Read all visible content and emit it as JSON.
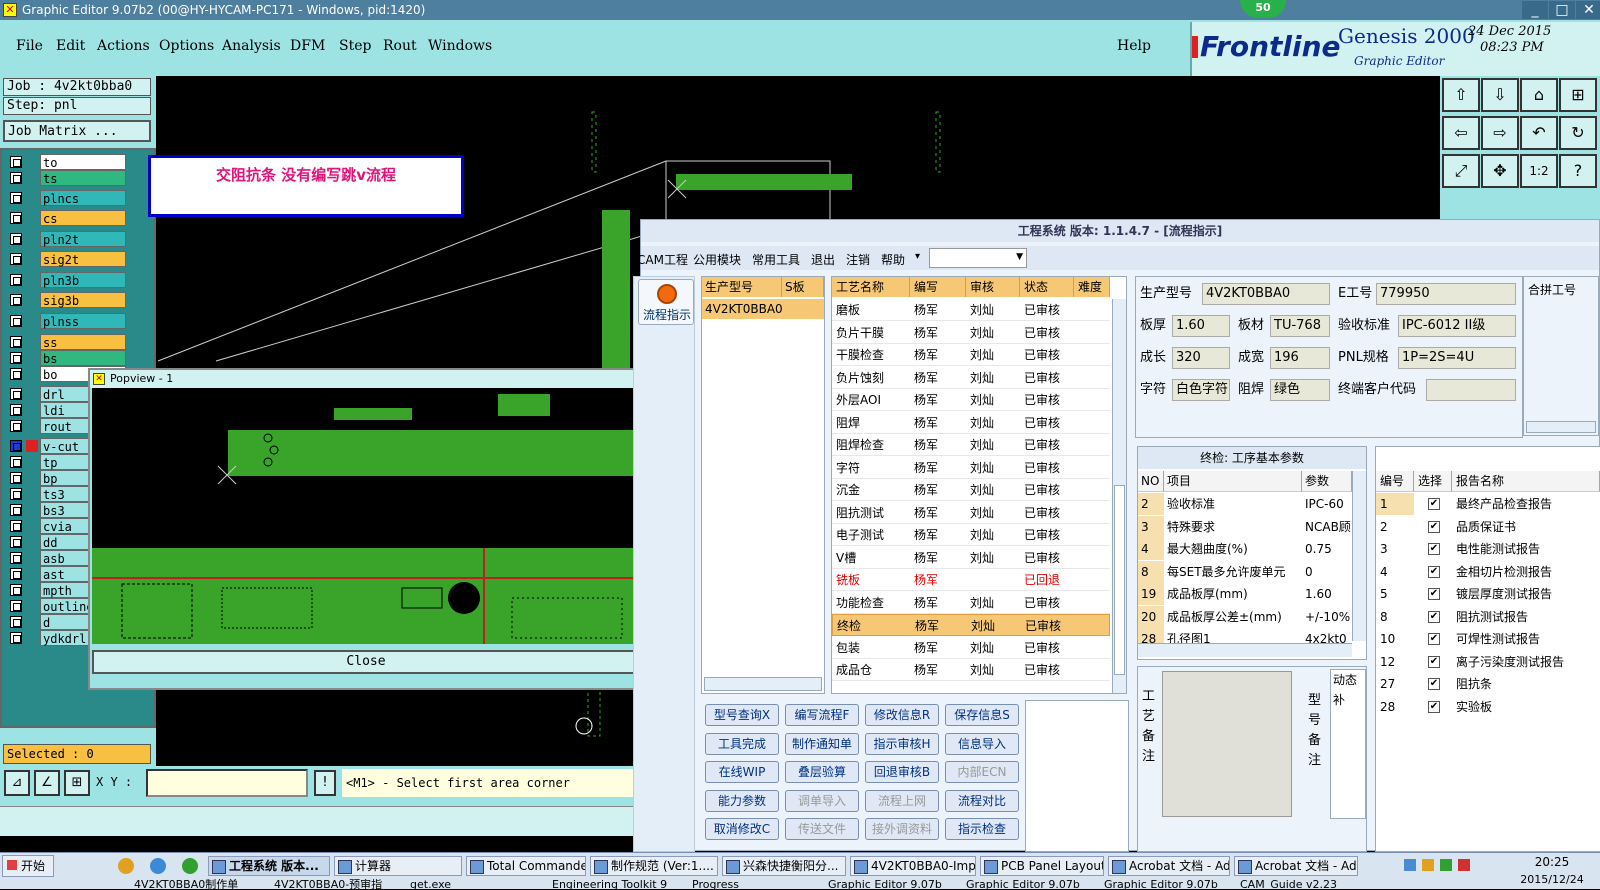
{
  "window": {
    "title": "Graphic Editor 9.07b2 (00@HY-HYCAM-PC171 - Windows, pid:1420)",
    "badge": "50"
  },
  "menu": {
    "items": [
      "File",
      "Edit",
      "Actions",
      "Options",
      "Analysis",
      "DFM",
      "Step",
      "Rout",
      "Windows"
    ],
    "help": "Help"
  },
  "brand": {
    "logo": "Frontline",
    "product": "Genesis 2000",
    "subtitle": "Graphic Editor",
    "date": "24 Dec 2015",
    "time": "08:23 PM"
  },
  "left": {
    "job": "Job : 4v2kt0bba0",
    "step": "Step: pnl",
    "job_matrix": "Job Matrix ...",
    "selected": "Selected : 0",
    "layers": [
      {
        "name": "to",
        "color": "#ffffff"
      },
      {
        "name": "ts",
        "color": "#30b880"
      },
      {
        "name": "plncs",
        "color": "#30b8b8"
      },
      {
        "name": "cs",
        "color": "#f8c040"
      },
      {
        "name": "pln2t",
        "color": "#30b8b8"
      },
      {
        "name": "sig2t",
        "color": "#f8c040"
      },
      {
        "name": "pln3b",
        "color": "#30b8b8"
      },
      {
        "name": "sig3b",
        "color": "#f8c040"
      },
      {
        "name": "plnss",
        "color": "#30b8b8"
      },
      {
        "name": "ss",
        "color": "#f8c040"
      },
      {
        "name": "bs",
        "color": "#30b880"
      },
      {
        "name": "bo",
        "color": "#ffffff"
      },
      {
        "name": "drl",
        "color": "#9ee3e3"
      },
      {
        "name": "ldi",
        "color": "#9ee3e3"
      },
      {
        "name": "rout",
        "color": "#9ee3e3"
      },
      {
        "name": "v-cut",
        "color": "#9ee3e3"
      },
      {
        "name": "tp",
        "color": "#9ee3e3"
      },
      {
        "name": "bp",
        "color": "#9ee3e3"
      },
      {
        "name": "ts3",
        "color": "#9ee3e3"
      },
      {
        "name": "bs3",
        "color": "#9ee3e3"
      },
      {
        "name": "cvia",
        "color": "#9ee3e3"
      },
      {
        "name": "dd",
        "color": "#9ee3e3"
      },
      {
        "name": "asb",
        "color": "#9ee3e3"
      },
      {
        "name": "ast",
        "color": "#9ee3e3"
      },
      {
        "name": "mpth",
        "color": "#9ee3e3"
      },
      {
        "name": "outline",
        "color": "#9ee3e3"
      },
      {
        "name": "d",
        "color": "#9ee3e3"
      },
      {
        "name": "ydkdrl",
        "color": "#9ee3e3"
      }
    ]
  },
  "note": "交阻抗条  没有编写跳v流程",
  "popview": {
    "title": "Popview - 1",
    "close": "Close"
  },
  "cmd": {
    "xy_label": "X Y :",
    "prompt": "<M1> - Select first area corner",
    "bang": "!"
  },
  "eng": {
    "title": "工程系统  版本: 1.1.4.7 - [流程指示]",
    "menu": [
      "CAM工程",
      "公用模块",
      "常用工具",
      "退出",
      "注销",
      "帮助"
    ],
    "side_button": "流程指示",
    "model_table": {
      "headers": [
        "生产型号",
        "S板"
      ],
      "rows": [
        [
          "4V2KT0BBA0",
          ""
        ]
      ]
    },
    "process_table": {
      "headers": [
        "工艺名称",
        "编写",
        "审核",
        "状态",
        "难度"
      ],
      "rows": [
        [
          "磨板",
          "杨军",
          "刘灿",
          "已审核",
          ""
        ],
        [
          "负片干膜",
          "杨军",
          "刘灿",
          "已审核",
          ""
        ],
        [
          "干膜检查",
          "杨军",
          "刘灿",
          "已审核",
          ""
        ],
        [
          "负片蚀刻",
          "杨军",
          "刘灿",
          "已审核",
          ""
        ],
        [
          "外层AOI",
          "杨军",
          "刘灿",
          "已审核",
          ""
        ],
        [
          "阻焊",
          "杨军",
          "刘灿",
          "已审核",
          ""
        ],
        [
          "阻焊检查",
          "杨军",
          "刘灿",
          "已审核",
          ""
        ],
        [
          "字符",
          "杨军",
          "刘灿",
          "已审核",
          ""
        ],
        [
          "沉金",
          "杨军",
          "刘灿",
          "已审核",
          ""
        ],
        [
          "阻抗测试",
          "杨军",
          "刘灿",
          "已审核",
          ""
        ],
        [
          "电子测试",
          "杨军",
          "刘灿",
          "已审核",
          ""
        ],
        [
          "V槽",
          "杨军",
          "刘灿",
          "已审核",
          ""
        ],
        [
          "铣板",
          "杨军",
          "",
          "已回退",
          ""
        ],
        [
          "功能检查",
          "杨军",
          "刘灿",
          "已审核",
          ""
        ],
        [
          "终检",
          "杨军",
          "刘灿",
          "已审核",
          ""
        ],
        [
          "包装",
          "杨军",
          "刘灿",
          "已审核",
          ""
        ],
        [
          "成品仓",
          "杨军",
          "刘灿",
          "已审核",
          ""
        ]
      ]
    },
    "info": {
      "model_label": "生产型号",
      "model": "4V2KT0BBA0",
      "ework_label": "E工号",
      "ework": "779950",
      "thick_label": "板厚",
      "thick": "1.60",
      "material_label": "板材",
      "material": "TU-768",
      "std_label": "验收标准",
      "std": "IPC-6012 II级",
      "len_label": "成长",
      "len": "320",
      "wid_label": "成宽",
      "wid": "196",
      "pnl_label": "PNL规格",
      "pnl": "1P=2S=4U",
      "char_label": "字符",
      "char": "白色字符",
      "mask_label": "阻焊",
      "mask": "绿色",
      "cust_label": "终端客户代码",
      "cust": "",
      "cutoff_label": "合拼工号"
    },
    "params": {
      "title": "终检: 工序基本参数",
      "headers": [
        "NO",
        "项目",
        "参数"
      ],
      "rows": [
        [
          "2",
          "验收标准",
          "IPC-60"
        ],
        [
          "3",
          "特殊要求",
          "NCAB顾"
        ],
        [
          "4",
          "最大翘曲度(%)",
          "0.75"
        ],
        [
          "8",
          "每SET最多允许废单元",
          "0"
        ],
        [
          "19",
          "成品板厚(mm)",
          "1.60"
        ],
        [
          "20",
          "成品板厚公差±(mm)",
          "+/-10%"
        ],
        [
          "28",
          "孔径图1",
          "4x2kt0"
        ]
      ]
    },
    "reports": {
      "headers": [
        "编号",
        "选择",
        "报告名称"
      ],
      "rows": [
        [
          "1",
          "最终产品检查报告"
        ],
        [
          "2",
          "品质保证书"
        ],
        [
          "3",
          "电性能测试报告"
        ],
        [
          "4",
          "金相切片检测报告"
        ],
        [
          "5",
          "镀层厚度测试报告"
        ],
        [
          "8",
          "阻抗测试报告"
        ],
        [
          "10",
          "可焊性测试报告"
        ],
        [
          "12",
          "离子污染度测试报告"
        ],
        [
          "27",
          "阻抗条"
        ],
        [
          "28",
          "实验板"
        ]
      ]
    },
    "buttons": [
      {
        "label": "型号查询X",
        "dis": false
      },
      {
        "label": "编写流程F",
        "dis": false
      },
      {
        "label": "修改信息R",
        "dis": false
      },
      {
        "label": "保存信息S",
        "dis": false
      },
      {
        "label": "工具完成",
        "dis": false
      },
      {
        "label": "制作通知单",
        "dis": false
      },
      {
        "label": "指示审核H",
        "dis": false
      },
      {
        "label": "信息导入",
        "dis": false
      },
      {
        "label": "在线WIP",
        "dis": false
      },
      {
        "label": "叠层验算",
        "dis": false
      },
      {
        "label": "回退审核B",
        "dis": false
      },
      {
        "label": "内部ECN",
        "dis": true
      },
      {
        "label": "能力参数",
        "dis": false
      },
      {
        "label": "调单导入",
        "dis": true
      },
      {
        "label": "流程上网",
        "dis": true
      },
      {
        "label": "流程对比",
        "dis": false
      },
      {
        "label": "取消修改C",
        "dis": false
      },
      {
        "label": "传送文件",
        "dis": true
      },
      {
        "label": "接外调资料",
        "dis": true
      },
      {
        "label": "指示检查",
        "dis": false
      }
    ],
    "remark1_label": "工艺备注",
    "remark2_label": "型号备注",
    "dynamic_label": "动态补"
  },
  "taskbar": {
    "start": "开始",
    "row1": [
      "工程系统  版本...",
      "计算器",
      "Total Commander ...",
      "制作规范 (Ver:1....",
      "兴森快捷衡阳分...",
      "4V2KT0BBA0-Impe...",
      "PCB Panel Layout...",
      "Acrobat 文档 - Ad...",
      "Acrobat 文档 - Ad..."
    ],
    "row2": [
      "4V2KT0BBA0制作单",
      "4V2KT0BBA0-预审指",
      "get.exe",
      "Engineering Toolkit 9",
      "Progress",
      "Graphic Editor 9.07b",
      "Graphic Editor 9.07b",
      "Graphic Editor 9.07b",
      "CAM_Guide v2.23"
    ],
    "time": "20:25",
    "date": "2015/12/24"
  },
  "colors": {
    "cyan": "#9ee3e3",
    "pcb_green": "#3aa32a",
    "accent_orange": "#f6c876",
    "magenta": "#e0157a"
  }
}
